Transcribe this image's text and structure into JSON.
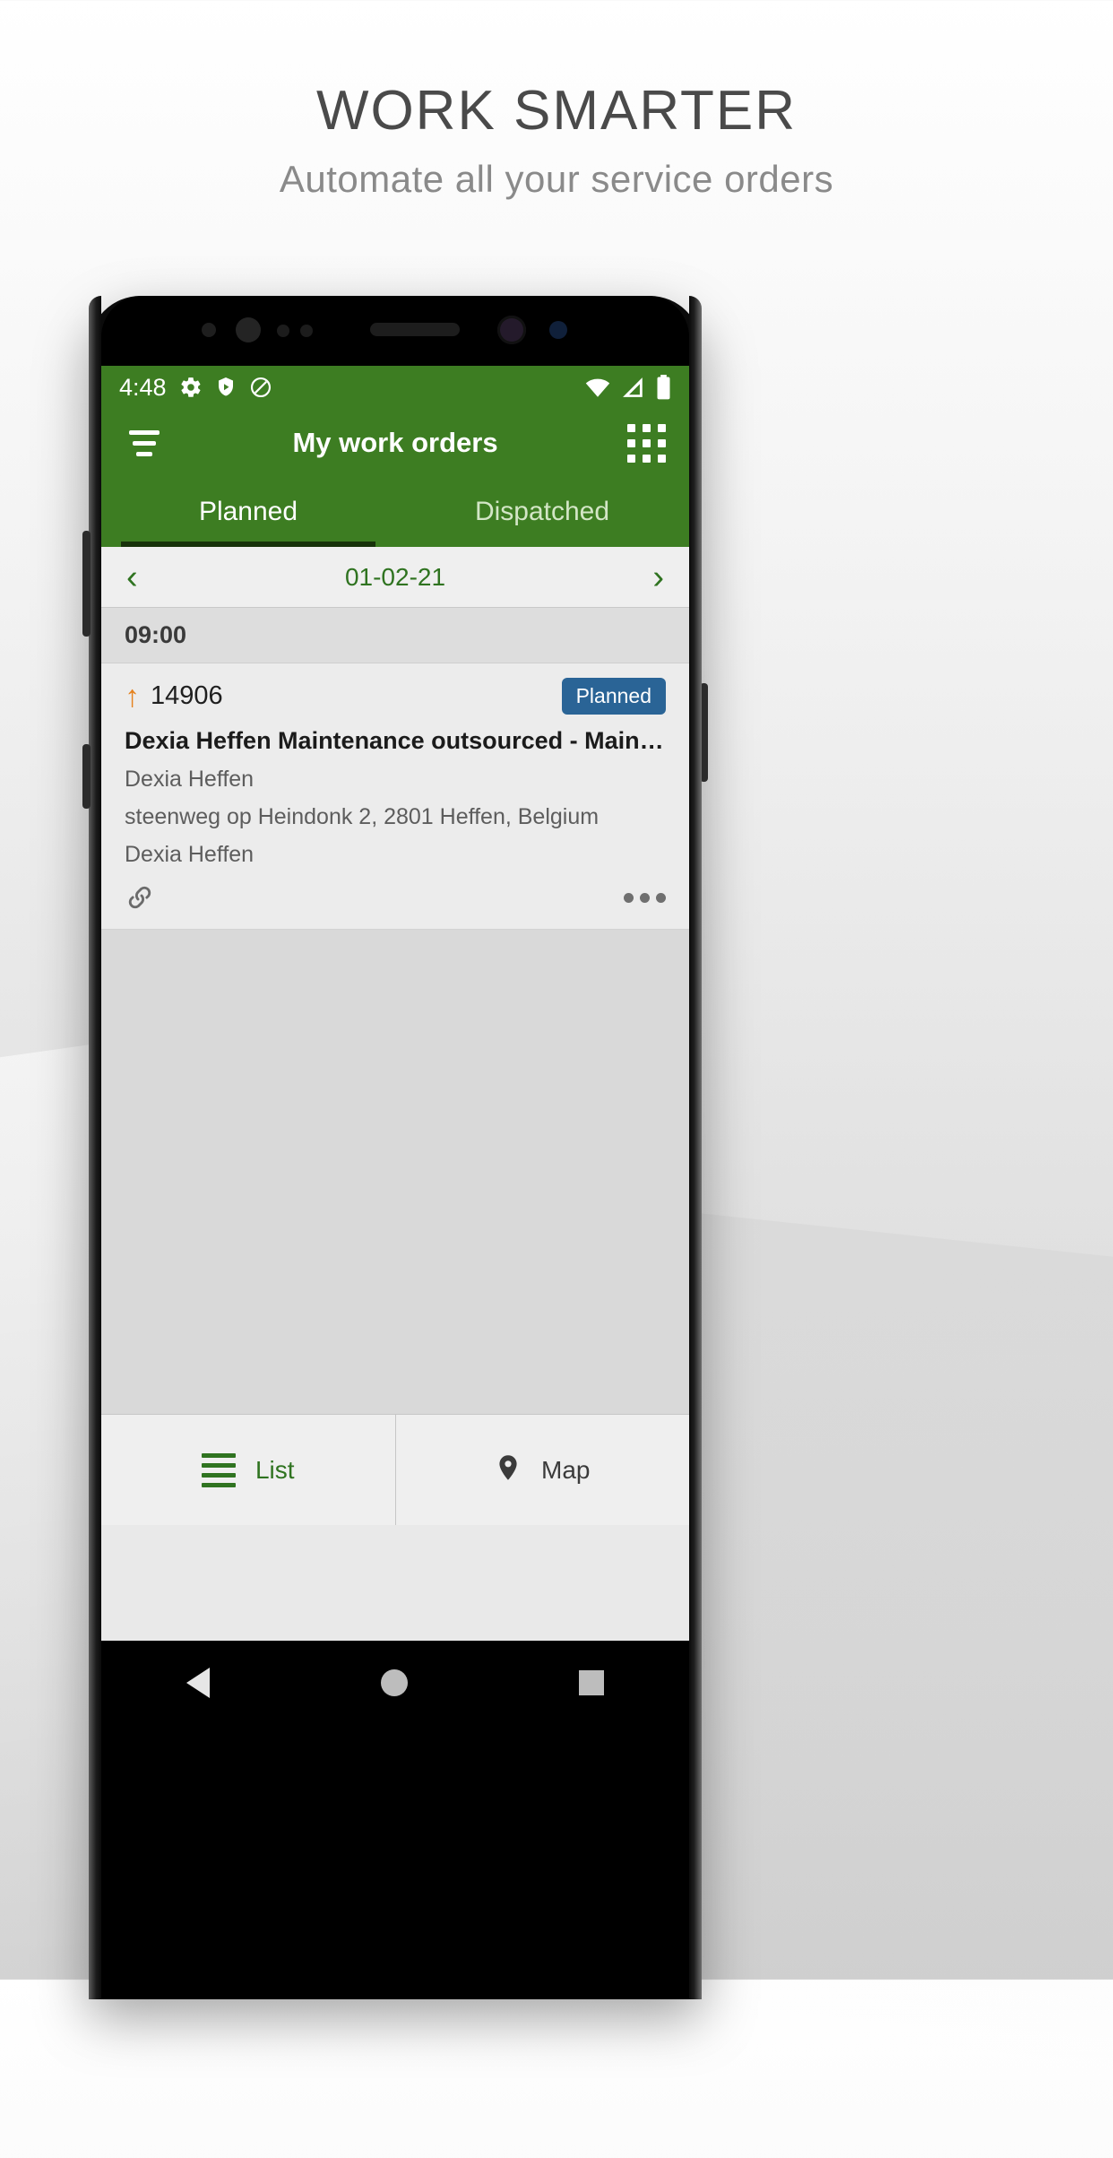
{
  "marketing": {
    "headline": "WORK SMARTER",
    "subhead": "Automate all your service orders"
  },
  "colors": {
    "brand_green": "#3d7d22",
    "accent_green": "#2f7320",
    "badge_blue": "#2a6496",
    "priority_orange": "#e5821f"
  },
  "statusbar": {
    "clock": "4:48",
    "icons_left": [
      "gear-icon",
      "shield-play-icon",
      "do-not-disturb-icon"
    ],
    "icons_right": [
      "wifi-icon",
      "signal-icon",
      "battery-icon"
    ]
  },
  "appbar": {
    "menu_icon": "filter-lines-icon",
    "title": "My work orders",
    "grid_icon": "apps-grid-icon"
  },
  "tabs": [
    {
      "label": "Planned",
      "active": true
    },
    {
      "label": "Dispatched",
      "active": false
    }
  ],
  "datebar": {
    "prev": "‹",
    "date": "01-02-21",
    "next": "›"
  },
  "schedule": {
    "time_header": "09:00",
    "card": {
      "priority_icon": "arrow-up-icon",
      "order_number": "14906",
      "status_badge": "Planned",
      "title": "Dexia Heffen Maintenance outsourced - Maintenance ou...",
      "customer": "Dexia Heffen",
      "address": "steenweg op Heindonk 2, 2801 Heffen, Belgium",
      "contact": "Dexia Heffen",
      "link_icon": "link-icon",
      "overflow_icon": "more-options-icon"
    }
  },
  "bottomnav": [
    {
      "label": "List",
      "icon": "list-lines-icon",
      "active": true
    },
    {
      "label": "Map",
      "icon": "map-pin-icon",
      "active": false
    }
  ],
  "androidnav": {
    "back": "back-triangle-icon",
    "home": "home-circle-icon",
    "recents": "recents-square-icon"
  }
}
